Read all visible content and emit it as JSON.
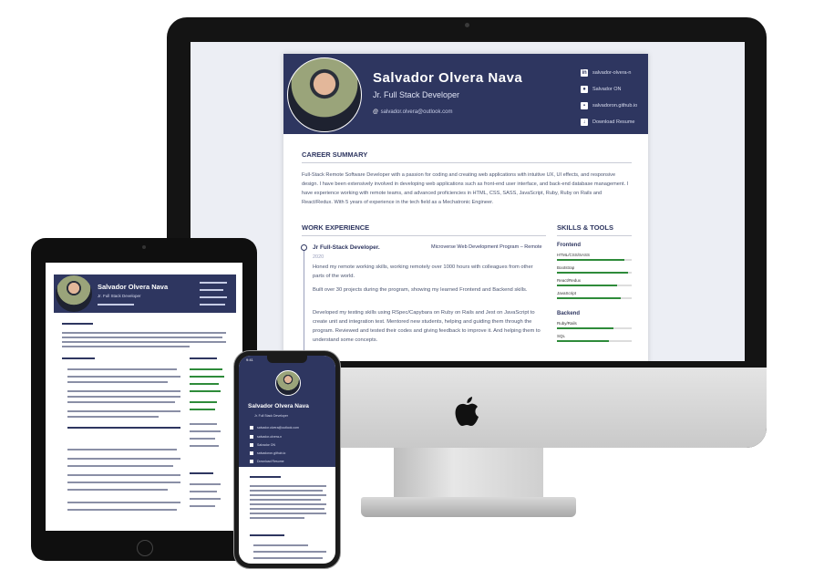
{
  "resume": {
    "name": "Salvador Olvera Nava",
    "title": "Jr. Full Stack Developer",
    "email": "salvador.olvera@outlook.com",
    "links": [
      {
        "icon": "linkedin-icon",
        "label": "salvador-olvera-n"
      },
      {
        "icon": "github-icon",
        "label": "Salvador ON"
      },
      {
        "icon": "website-icon",
        "label": "salvadoron.github.io"
      },
      {
        "icon": "download-icon",
        "label": "Download Resume"
      }
    ],
    "career_summary_heading": "CAREER SUMMARY",
    "career_summary": "Full-Stack Remote Software Developer with a passion for coding and creating web applications with intuitive UX, UI effects, and responsive design. I have been extensively involved in developing web applications such as front-end user interface, and back-end database management. I have experience working with remote teams, and advanced proficiencies in HTML, CSS, SASS, JavaScript, Ruby, Ruby on Rails and React/Redux. With 5 years of experience in the tech field as a Mechatronic Engineer.",
    "work_heading": "WORK EXPERIENCE",
    "job_title": "Jr Full-Stack Developer.",
    "job_company": "Microverse Web Development Program – Remote",
    "job_year": "2020",
    "job_points": [
      "Honed my remote working skills, working remotely over 1000 hours with colleagues from other parts of the world.",
      "Built over 30 projects during the program, showing my learned Frontend and Backend skills.",
      "Developed my testing skills using RSpec/Capybara on Ruby on Rails and Jest on JavaScript to create unit and integration test. Mentored new students, helping and guiding them through the program. Reviewed and tested their codes and giving feedback to improve it. And helping them to understand some concepts."
    ],
    "skills_heading": "SKILLS & TOOLS",
    "frontend_heading": "Frontend",
    "frontend_skills": [
      {
        "label": "HTML/CSS/SASS",
        "level": 0.9
      },
      {
        "label": "Bootstrap",
        "level": 0.95
      },
      {
        "label": "React/Redux",
        "level": 0.8
      },
      {
        "label": "JavaScript",
        "level": 0.85
      }
    ],
    "backend_heading": "Backend",
    "backend_skills": [
      {
        "label": "Ruby/Rails",
        "level": 0.75
      },
      {
        "label": "SQL",
        "level": 0.7
      }
    ]
  },
  "mobile": {
    "status_time": "9:41"
  },
  "colors": {
    "header_navy": "#2e3660",
    "skill_green": "#2e8b3a"
  }
}
